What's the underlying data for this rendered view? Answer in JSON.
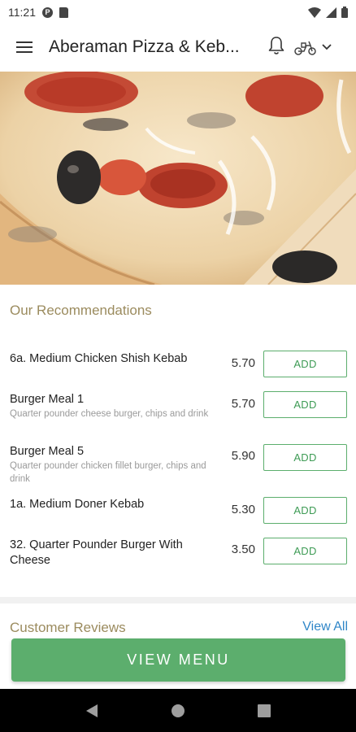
{
  "status_bar": {
    "time": "11:21",
    "icons": [
      "pocket-casts-icon",
      "sd-card-icon",
      "wifi-icon",
      "signal-icon",
      "battery-icon"
    ]
  },
  "app_bar": {
    "title": "Aberaman Pizza & Keb...",
    "icons": [
      "menu-icon",
      "bell-icon",
      "scooter-icon",
      "chevron-down-icon"
    ]
  },
  "hero": {
    "image": "pizza-photo"
  },
  "recommendations": {
    "title": "Our Recommendations",
    "items": [
      {
        "name": "6a. Medium Chicken Shish Kebab",
        "description": "",
        "price": "5.70",
        "button": "ADD"
      },
      {
        "name": "Burger Meal 1",
        "description": "Quarter pounder cheese burger, chips and drink",
        "price": "5.70",
        "button": "ADD"
      },
      {
        "name": "Burger Meal 5",
        "description": "Quarter pounder chicken fillet burger, chips and drink",
        "price": "5.90",
        "button": "ADD"
      },
      {
        "name": "1a. Medium Doner Kebab",
        "description": "",
        "price": "5.30",
        "button": "ADD"
      },
      {
        "name": "32. Quarter Pounder Burger With Cheese",
        "description": "",
        "price": "3.50",
        "button": "ADD"
      }
    ]
  },
  "reviews": {
    "title": "Customer Reviews",
    "view_all": "View All"
  },
  "cta": {
    "label": "VIEW MENU"
  },
  "nav_bar": {
    "icons": [
      "back-icon",
      "home-icon",
      "recents-icon"
    ]
  },
  "colors": {
    "accent_green": "#5cae6d",
    "section_title": "#9b8b5e",
    "link_blue": "#2f86c8"
  }
}
